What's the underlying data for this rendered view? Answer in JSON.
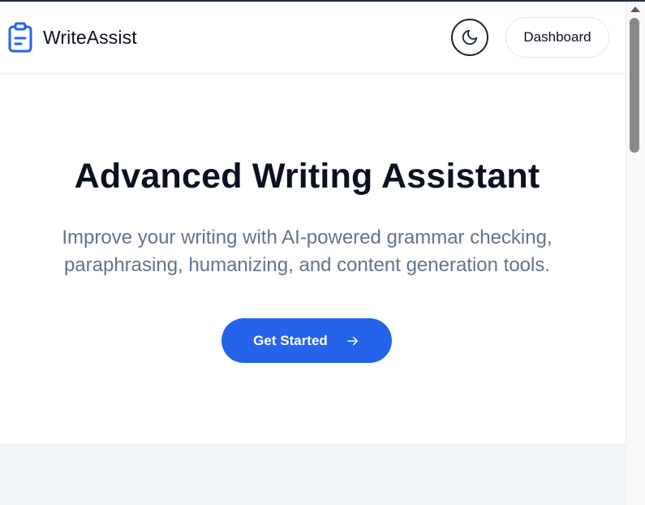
{
  "header": {
    "brand_name": "WriteAssist",
    "brand_icon": "clipboard-icon",
    "theme_toggle_icon": "moon-icon",
    "dashboard_label": "Dashboard"
  },
  "hero": {
    "title": "Advanced Writing Assistant",
    "subtitle": "Improve your writing with AI-powered grammar checking, paraphrasing, humanizing, and content generation tools.",
    "cta_label": "Get Started",
    "cta_icon": "arrow-right-icon"
  },
  "colors": {
    "accent": "#2563eb",
    "text_primary": "#0b1120",
    "text_muted": "#64748b",
    "band_background": "#f1f4f9"
  }
}
